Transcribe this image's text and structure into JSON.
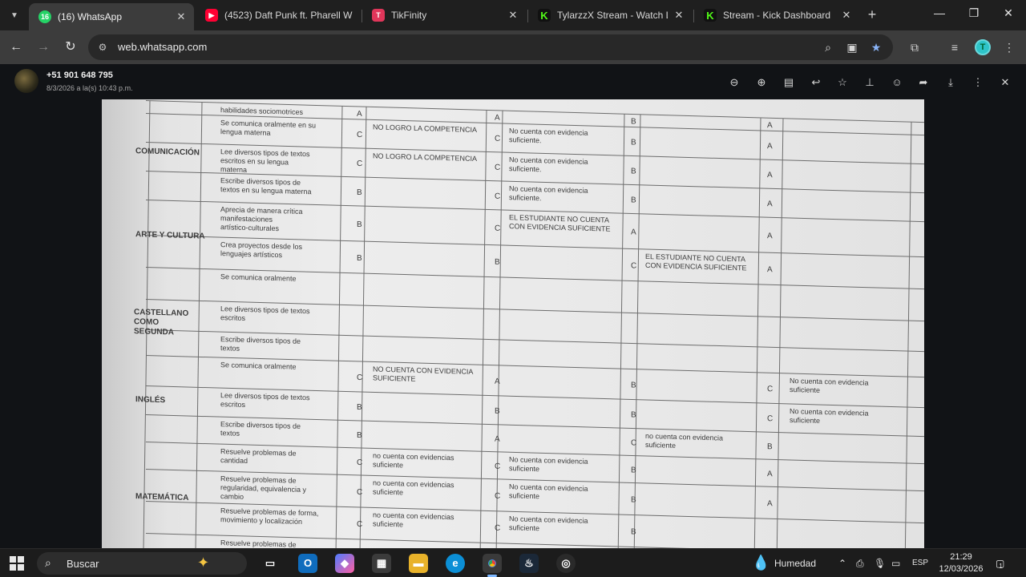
{
  "tabs": [
    {
      "title": "(16) WhatsApp",
      "badge": "16",
      "active": true,
      "icon": "whatsapp-icon",
      "color": "#25d366"
    },
    {
      "title": "(4523) Daft Punk ft. Pharell W",
      "icon": "youtube-icon",
      "color": "#ff0033"
    },
    {
      "title": "TikFinity",
      "icon": "tikfinity-icon",
      "color": "#e0365a"
    },
    {
      "title": "TylarzzX Stream - Watch Live",
      "icon": "kick-icon",
      "color": "#53fc18"
    },
    {
      "title": "Stream - Kick Dashboard",
      "icon": "kick-icon",
      "color": "#53fc18"
    }
  ],
  "address_bar": {
    "url": "web.whatsapp.com"
  },
  "viewer": {
    "sender": "+51 901 648 795",
    "sent_date": "8/3/2026 a la(s) 10:43 p.m."
  },
  "document": {
    "areas": [
      {
        "name": "COMUNICACIÓN"
      },
      {
        "name": "ARTE Y CULTURA"
      },
      {
        "name": "CASTELLANO COMO SEGUNDA LENGUA"
      },
      {
        "name": "INGLÉS"
      },
      {
        "name": "MATEMÁTICA"
      }
    ],
    "rows": [
      {
        "comp": "habilidades sociomotrices",
        "g1": "A",
        "c1": "",
        "g2": "A",
        "c2": "",
        "g3": "B",
        "c3": "",
        "g4": "A",
        "c4": ""
      },
      {
        "comp": "Se comunica oralmente en su lengua materna",
        "g1": "C",
        "c1": "NO LOGRO LA COMPETENCIA",
        "g2": "C",
        "c2": "No cuenta con evidencia suficiente.",
        "g3": "B",
        "c3": "",
        "g4": "A",
        "c4": ""
      },
      {
        "comp": "Lee diversos tipos de textos escritos en su lengua materna",
        "g1": "C",
        "c1": "NO LOGRO LA COMPETENCIA",
        "g2": "C",
        "c2": "No cuenta con evidencia suficiente.",
        "g3": "B",
        "c3": "",
        "g4": "A",
        "c4": ""
      },
      {
        "comp": "Escribe diversos tipos de textos en su lengua materna",
        "g1": "B",
        "c1": "",
        "g2": "C",
        "c2": "No cuenta con evidencia suficiente.",
        "g3": "B",
        "c3": "",
        "g4": "A",
        "c4": ""
      },
      {
        "comp": "Aprecia de manera crítica manifestaciones artístico-culturales",
        "g1": "B",
        "c1": "",
        "g2": "C",
        "c2": "EL ESTUDIANTE NO CUENTA CON EVIDENCIA SUFICIENTE",
        "g3": "A",
        "c3": "",
        "g4": "A",
        "c4": ""
      },
      {
        "comp": "Crea proyectos desde los lenguajes artísticos",
        "g1": "B",
        "c1": "",
        "g2": "B",
        "c2": "",
        "g3": "C",
        "c3": "EL ESTUDIANTE NO CUENTA CON EVIDENCIA SUFICIENTE",
        "g4": "A",
        "c4": ""
      },
      {
        "comp": "Se comunica oralmente",
        "g1": "",
        "c1": "",
        "g2": "",
        "c2": "",
        "g3": "",
        "c3": "",
        "g4": "",
        "c4": ""
      },
      {
        "comp": "Lee diversos tipos de textos escritos",
        "g1": "",
        "c1": "",
        "g2": "",
        "c2": "",
        "g3": "",
        "c3": "",
        "g4": "",
        "c4": ""
      },
      {
        "comp": "Escribe diversos tipos de textos",
        "g1": "",
        "c1": "",
        "g2": "",
        "c2": "",
        "g3": "",
        "c3": "",
        "g4": "",
        "c4": ""
      },
      {
        "comp": "Se comunica oralmente",
        "g1": "C",
        "c1": "NO CUENTA CON EVIDENCIA SUFICIENTE",
        "g2": "A",
        "c2": "",
        "g3": "B",
        "c3": "",
        "g4": "C",
        "c4": "No cuenta con evidencia suficiente"
      },
      {
        "comp": "Lee diversos tipos de textos escritos",
        "g1": "B",
        "c1": "",
        "g2": "B",
        "c2": "",
        "g3": "B",
        "c3": "",
        "g4": "C",
        "c4": "No cuenta con evidencia suficiente"
      },
      {
        "comp": "Escribe diversos tipos de textos",
        "g1": "B",
        "c1": "",
        "g2": "A",
        "c2": "",
        "g3": "C",
        "c3": "no cuenta con evidencia suficiente",
        "g4": "B",
        "c4": ""
      },
      {
        "comp": "Resuelve problemas de cantidad",
        "g1": "C",
        "c1": "no cuenta con evidencias suficiente",
        "g2": "C",
        "c2": "No cuenta con evidencia suficiente",
        "g3": "B",
        "c3": "",
        "g4": "A",
        "c4": ""
      },
      {
        "comp": "Resuelve problemas de regularidad, equivalencia y cambio",
        "g1": "C",
        "c1": "no cuenta con evidencias suficiente",
        "g2": "C",
        "c2": "No cuenta con evidencia suficiente",
        "g3": "B",
        "c3": "",
        "g4": "A",
        "c4": ""
      },
      {
        "comp": "Resuelve problemas de forma, movimiento y localización",
        "g1": "C",
        "c1": "no cuenta con evidencias suficiente",
        "g2": "C",
        "c2": "No cuenta con evidencia suficiente",
        "g3": "B",
        "c3": "",
        "g4": "",
        "c4": ""
      },
      {
        "comp": "Resuelve problemas de gestión de",
        "g1": "",
        "c1": "",
        "g2": "",
        "c2": "",
        "g3": "",
        "c3": "",
        "g4": "",
        "c4": ""
      }
    ]
  },
  "taskbar": {
    "search_label": "Buscar",
    "weather": "Humedad",
    "language": "ESP",
    "time": "21:29",
    "date": "12/03/2026",
    "notifications": "1"
  }
}
